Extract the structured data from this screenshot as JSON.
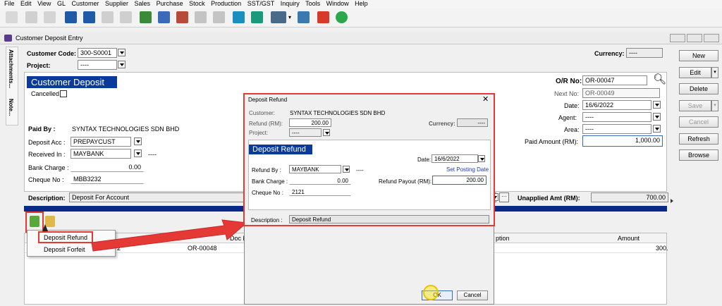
{
  "menu_items": [
    "File",
    "Edit",
    "View",
    "GL",
    "Customer",
    "Supplier",
    "Sales",
    "Purchase",
    "Stock",
    "Production",
    "SST/GST",
    "Inquiry",
    "Tools",
    "Window",
    "Help"
  ],
  "window_title": "Customer Deposit Entry",
  "side_tabs": [
    "Attachments...",
    "Note..."
  ],
  "header": {
    "customer_code_label": "Customer Code:",
    "customer_code_value": "300-S0001",
    "project_label": "Project:",
    "project_value": "----",
    "currency_label": "Currency:",
    "currency_value": "----"
  },
  "form": {
    "title": "Customer Deposit",
    "cancelled_label": "Cancelled",
    "or_no_label": "O/R No:",
    "or_no_value": "OR-00047",
    "next_no_label": "Next No:",
    "next_no_value": "OR-00049",
    "date_label": "Date:",
    "date_value": "16/6/2022",
    "agent_label": "Agent:",
    "agent_value": "----",
    "area_label": "Area:",
    "area_value": "----",
    "paid_by_label": "Paid By :",
    "paid_by_value": "SYNTAX TECHNOLOGIES SDN BHD",
    "deposit_acc_label": "Deposit Acc :",
    "deposit_acc_value": "PREPAYCUST",
    "received_in_label": "Received In :",
    "received_in_value": "MAYBANK",
    "received_in_dashes": "----",
    "bank_charge_label": "Bank Charge :",
    "bank_charge_value": "0.00",
    "cheque_no_label": "Cheque No :",
    "cheque_no_value": "MBB3232",
    "paid_amount_label": "Paid Amount (RM):",
    "paid_amount_value": "1,000.00",
    "description_label": "Description:",
    "description_value": "Deposit For Account",
    "unapplied_label": "Unapplied Amt (RM):",
    "unapplied_value": "700.00"
  },
  "grid": {
    "columns": [
      "Doc N",
      "ption",
      "Amount"
    ],
    "rows": [
      {
        "col_a": "2",
        "doc_no": "OR-00048",
        "amount": "300."
      }
    ]
  },
  "popup_menu": [
    "Deposit Refund",
    "Deposit Forfeit"
  ],
  "right_buttons": [
    "New",
    "Edit",
    "Delete",
    "Save",
    "Cancel",
    "Refresh",
    "Browse"
  ],
  "dialog": {
    "title": "Deposit Refund",
    "customer_label": "Customer:",
    "customer_value": "SYNTAX TECHNOLOGIES SDN BHD",
    "refund_label": "Refund (RM):",
    "refund_value": "200.00",
    "currency_label": "Currency:",
    "currency_value": "----",
    "project_label": "Project:",
    "project_value": "----",
    "section_title": "Deposit Refund",
    "date_label": "Date:",
    "date_value": "16/6/2022",
    "set_posting_date": "Set Posting Date",
    "refund_by_label": "Refund By :",
    "refund_by_value": "MAYBANK",
    "refund_by_dashes": "----",
    "bank_charge_label": "Bank Charge :",
    "bank_charge_value": "0.00",
    "refund_payout_label": "Refund Payout (RM):",
    "refund_payout_value": "200.00",
    "cheque_no_label": "Cheque No :",
    "cheque_no_value": "2121",
    "description_label": "Description :",
    "description_value": "Deposit Refund",
    "ok_label": "OK",
    "cancel_label": "Cancel"
  }
}
